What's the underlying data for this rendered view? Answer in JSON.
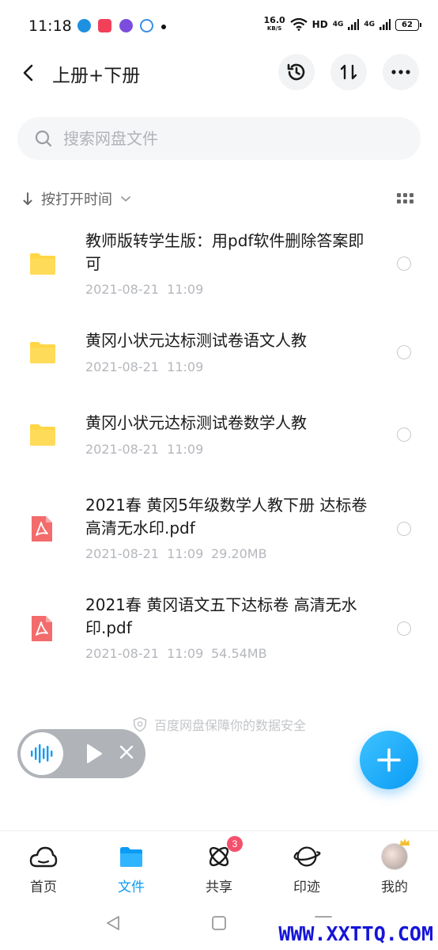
{
  "status_bar": {
    "time": "11:18",
    "net_speed_value": "16.0",
    "net_speed_unit": "KB/S",
    "hd_label": "HD",
    "net_type_1": "4G",
    "net_type_2": "4G",
    "battery": "62"
  },
  "header": {
    "title": "上册+下册"
  },
  "search": {
    "placeholder": "搜索网盘文件"
  },
  "sort": {
    "label": "按打开时间"
  },
  "files": [
    {
      "type": "folder",
      "name": "教师版转学生版：用pdf软件删除答案即可",
      "date": "2021-08-21  11:09",
      "size": ""
    },
    {
      "type": "folder",
      "name": "黄冈小状元达标测试卷语文人教",
      "date": "2021-08-21  11:09",
      "size": ""
    },
    {
      "type": "folder",
      "name": "黄冈小状元达标测试卷数学人教",
      "date": "2021-08-21  11:09",
      "size": ""
    },
    {
      "type": "pdf",
      "name": "2021春 黄冈5年级数学人教下册 达标卷 高清无水印.pdf",
      "date": "2021-08-21  11:09",
      "size": "29.20MB"
    },
    {
      "type": "pdf",
      "name": "2021春 黄冈语文五下达标卷 高清无水印.pdf",
      "date": "2021-08-21  11:09",
      "size": "54.54MB"
    }
  ],
  "security_note": "百度网盘保障你的数据安全",
  "bottom_nav": {
    "items": [
      {
        "label": "首页",
        "icon": "cloud-icon"
      },
      {
        "label": "文件",
        "icon": "folder-icon",
        "active": true
      },
      {
        "label": "共享",
        "icon": "atom-icon",
        "badge": "3"
      },
      {
        "label": "印迹",
        "icon": "planet-icon"
      },
      {
        "label": "我的",
        "icon": "avatar"
      }
    ]
  },
  "watermark": "WWW.XXTTQ.COM",
  "colors": {
    "accent": "#0a9bf5",
    "folder": "#ffd646",
    "pdf": "#f36b6b",
    "badge": "#f4506c"
  }
}
